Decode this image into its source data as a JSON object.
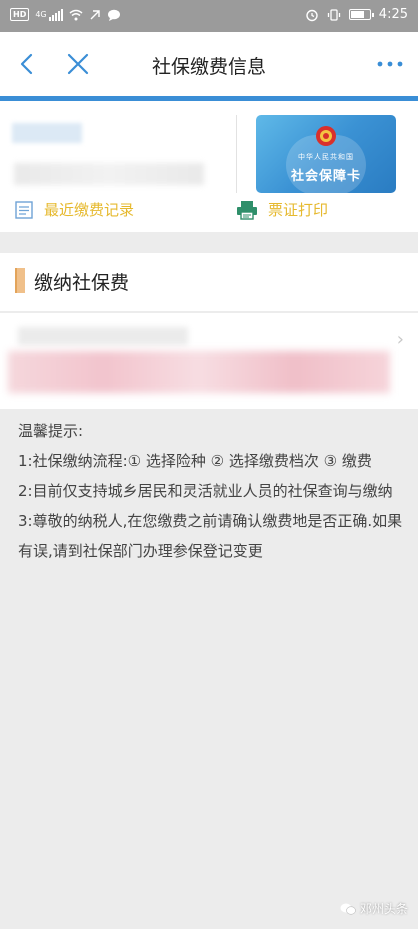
{
  "status_bar": {
    "network_hd": "HD",
    "network_type": "4G",
    "time": "4:25"
  },
  "nav": {
    "title": "社保缴费信息"
  },
  "card": {
    "subtitle": "中华人民共和国",
    "title": "社会保障卡"
  },
  "links": {
    "recent_payments": "最近缴费记录",
    "ticket_print": "票证打印"
  },
  "section": {
    "title": "缴纳社保费"
  },
  "tips": {
    "heading": "温馨提示:",
    "line1": "1:社保缴纳流程:① 选择险种 ② 选择缴费档次 ③ 缴费",
    "line2": "2:目前仅支持城乡居民和灵活就业人员的社保查询与缴纳",
    "line3": "3:尊敬的纳税人,在您缴费之前请确认缴费地是否正确.如果有误,请到社保部门办理参保登记变更"
  },
  "watermark": {
    "text": "邓州头条"
  },
  "colors": {
    "accent_blue": "#3a8ed6",
    "link_gold": "#e6b92e",
    "print_icon_green": "#2f8f6a",
    "section_bar": "#f0c08a"
  }
}
